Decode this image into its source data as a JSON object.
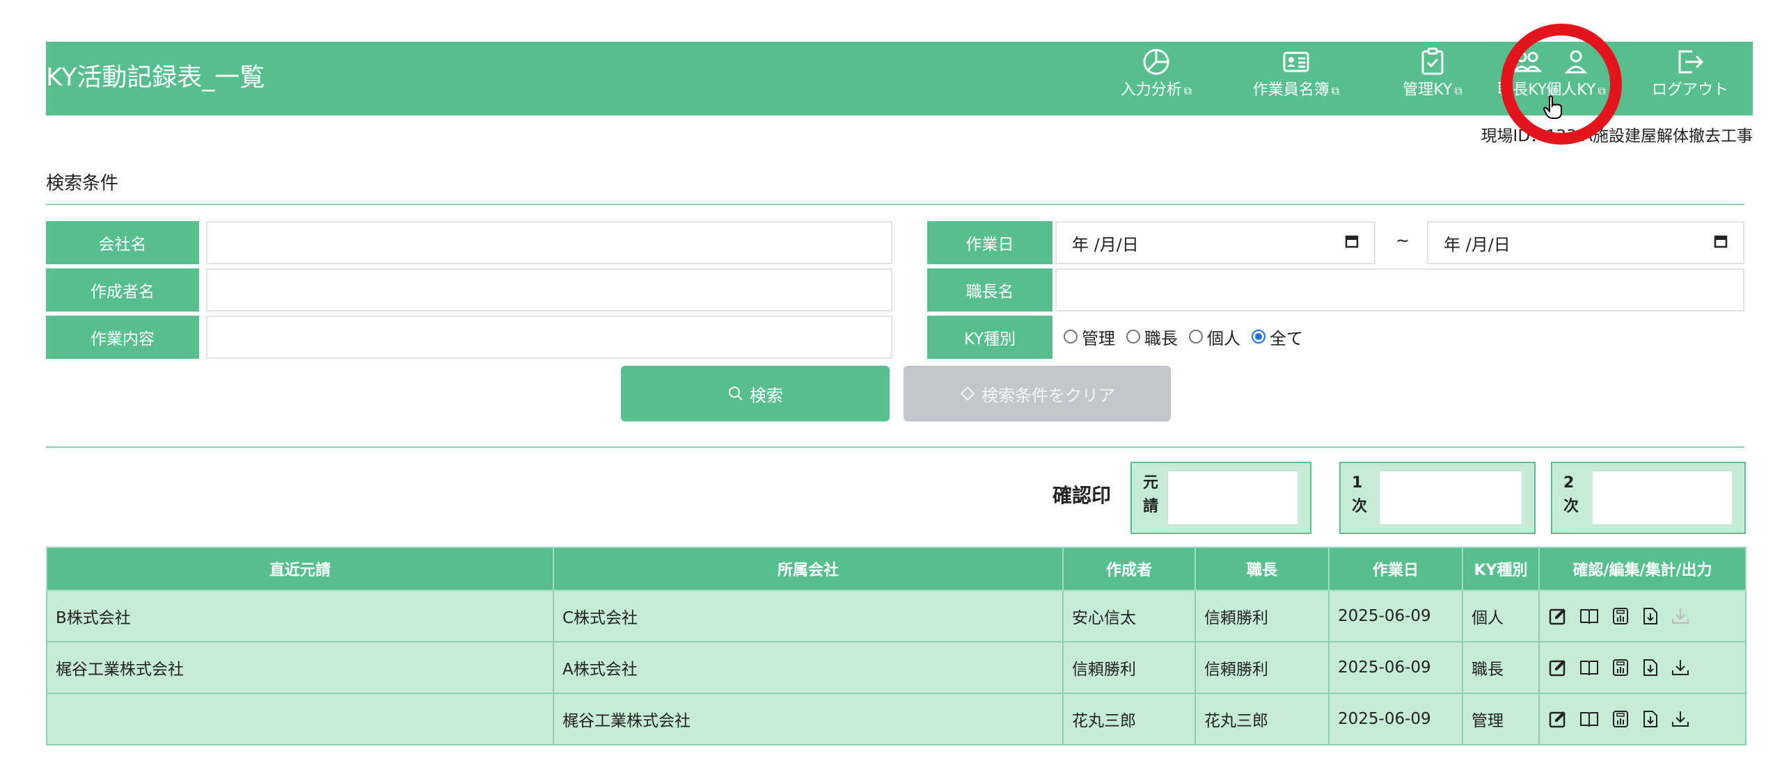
{
  "header": {
    "title": "KY活動記録表_一覧",
    "nav": [
      {
        "label": "入力分析",
        "icon": "pie-chart-icon"
      },
      {
        "label": "作業員名簿",
        "icon": "id-card-icon"
      },
      {
        "label": "管理KY",
        "icon": "clipboard-check-icon"
      },
      {
        "label": "職長KY",
        "icon": "people-icon"
      },
      {
        "label": "個人KY",
        "icon": "person-icon"
      },
      {
        "label": "ログアウト",
        "icon": "logout-icon"
      }
    ],
    "external_link_icon": "external-link-icon"
  },
  "site_info": "現場ID：123 A施設建屋解体撤去工事",
  "search": {
    "section_title": "検索条件",
    "company_label": "会社名",
    "company_value": "",
    "author_label": "作成者名",
    "author_value": "",
    "content_label": "作業内容",
    "content_value": "",
    "date_label": "作業日",
    "date_from": "年 /月/日",
    "date_tilde": "~",
    "date_to": "年 /月/日",
    "foreman_label": "職長名",
    "foreman_value": "",
    "type_label": "KY種別",
    "type_options": [
      {
        "label": "管理",
        "checked": false
      },
      {
        "label": "職長",
        "checked": false
      },
      {
        "label": "個人",
        "checked": false
      },
      {
        "label": "全て",
        "checked": true
      }
    ],
    "search_button": "検索",
    "clear_button": "検索条件をクリア"
  },
  "confirm": {
    "label": "確認印",
    "boxes": [
      {
        "key": "元請"
      },
      {
        "key": "1次"
      },
      {
        "key": "2次"
      }
    ]
  },
  "table": {
    "columns": [
      "直近元請",
      "所属会社",
      "作成者",
      "職長",
      "作業日",
      "KY種別",
      "確認/編集/集計/出力"
    ],
    "rows": [
      {
        "prime": "B株式会社",
        "company": "C株式会社",
        "author": "安心信太",
        "foreman": "信頼勝利",
        "date": "2025-06-09",
        "type": "個人",
        "download_enabled": false
      },
      {
        "prime": "梶谷工業株式会社",
        "company": "A株式会社",
        "author": "信頼勝利",
        "foreman": "信頼勝利",
        "date": "2025-06-09",
        "type": "職長",
        "download_enabled": true
      },
      {
        "prime": "",
        "company": "梶谷工業株式会社",
        "author": "花丸三郎",
        "foreman": "花丸三郎",
        "date": "2025-06-09",
        "type": "管理",
        "download_enabled": true
      }
    ],
    "row_action_icons": [
      "edit-icon",
      "book-icon",
      "calculator-icon",
      "download-doc-icon",
      "download-icon"
    ]
  },
  "colors": {
    "accent": "#57bf8e",
    "row_bg": "#c6ecd6",
    "highlight_ring": "#e3141c",
    "clear_button": "#c3c7cc"
  }
}
